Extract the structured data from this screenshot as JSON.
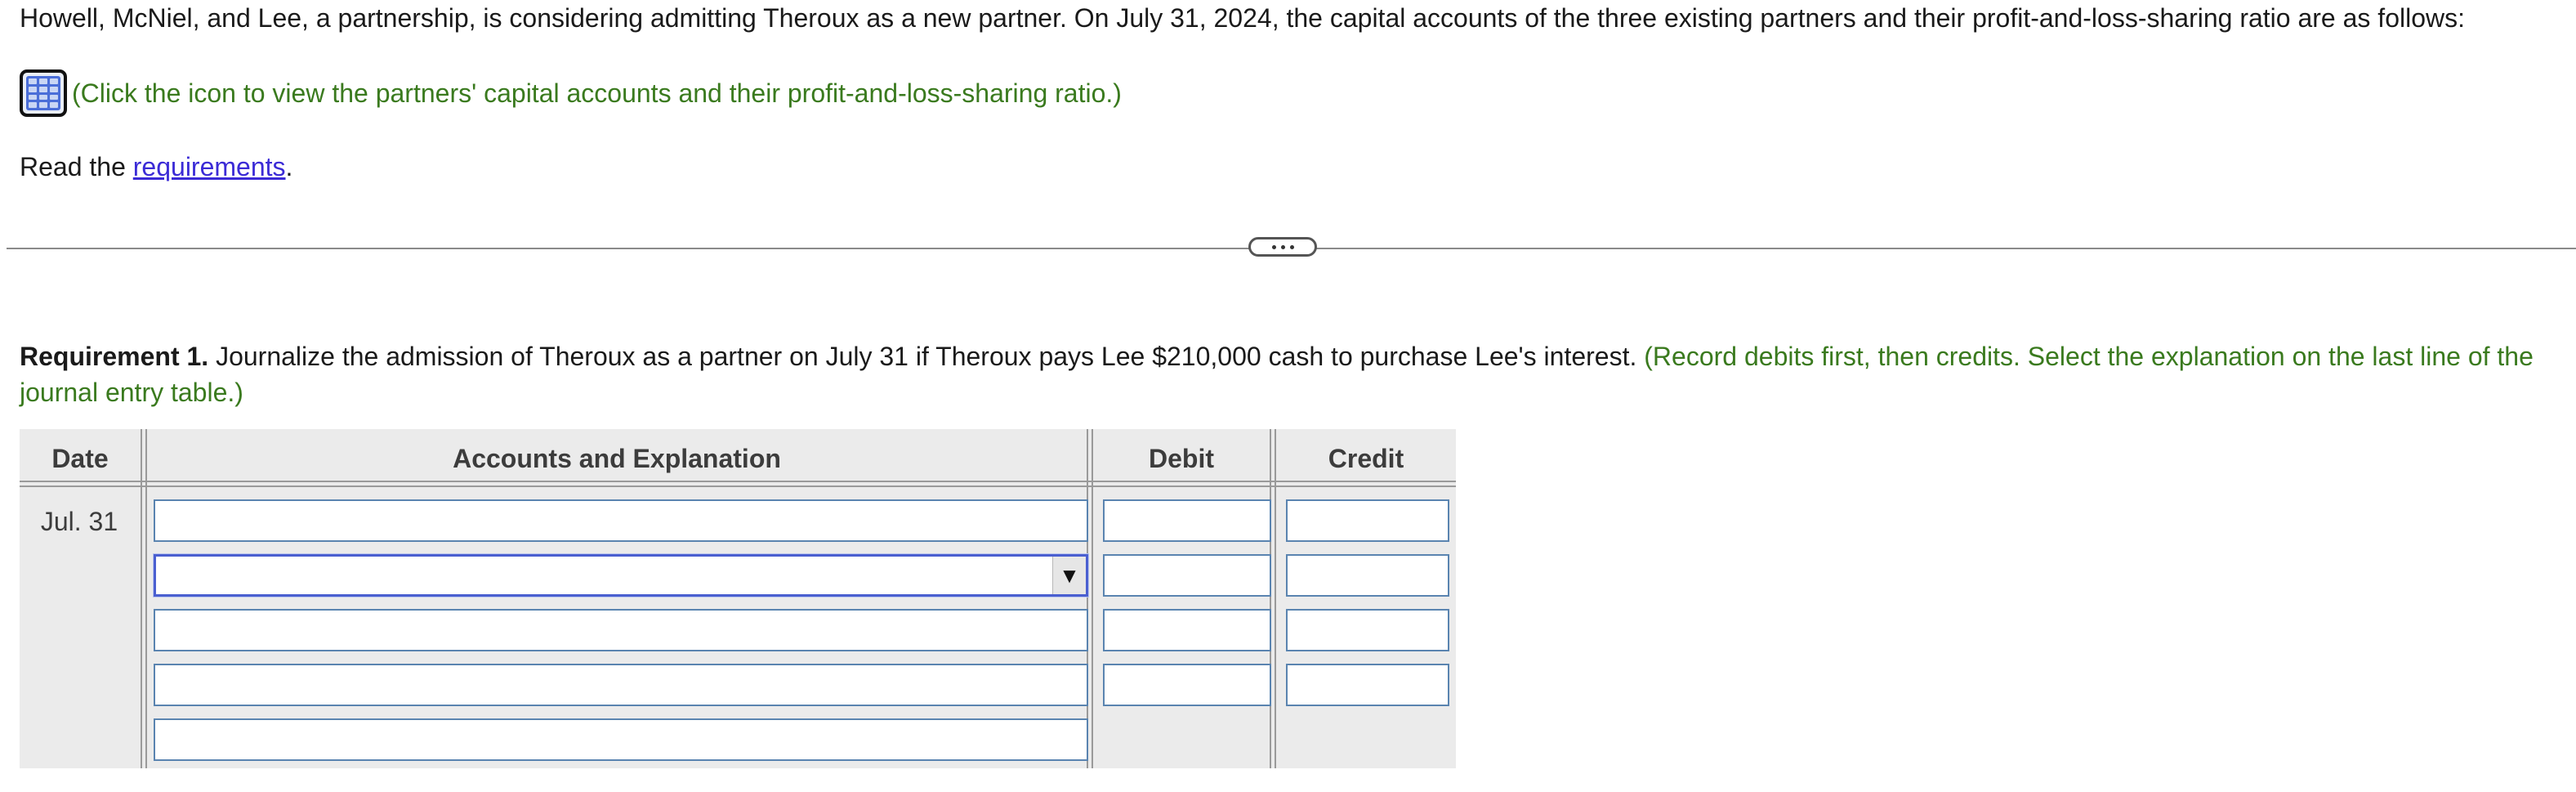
{
  "intro": {
    "text": "Howell, McNiel, and Lee, a partnership, is considering admitting Theroux as a new partner. On July 31, 2024, the capital accounts of the three existing partners and their profit-and-loss-sharing ratio are as follows:"
  },
  "data_link": {
    "icon": "table-grid-icon",
    "text": "(Click the icon to view the partners' capital accounts and their profit-and-loss-sharing ratio.)"
  },
  "read_line": {
    "prefix": "Read the ",
    "link": "requirements",
    "suffix": "."
  },
  "requirement": {
    "label": "Requirement 1.",
    "text": " Journalize the admission of Theroux as a partner on July 31 if Theroux pays Lee $210,000 cash to purchase Lee's interest. ",
    "hint": "(Record debits first, then credits. Select the explanation on the last line of the journal entry table.)"
  },
  "journal": {
    "headers": {
      "date": "Date",
      "accounts": "Accounts and Explanation",
      "debit": "Debit",
      "credit": "Credit"
    },
    "date_value": "Jul. 31",
    "rows": [
      {
        "account": "",
        "debit": "",
        "credit": ""
      },
      {
        "account": "",
        "debit": "",
        "credit": "",
        "dropdown": true
      },
      {
        "account": "",
        "debit": "",
        "credit": ""
      },
      {
        "account": "",
        "debit": "",
        "credit": ""
      },
      {
        "account": ""
      }
    ],
    "dropdown_arrow": "▼"
  },
  "colors": {
    "hint_green": "#3a7a1e",
    "link_blue": "#3b2bd6",
    "field_border": "#5a84b0",
    "table_bg": "#ebebeb"
  }
}
